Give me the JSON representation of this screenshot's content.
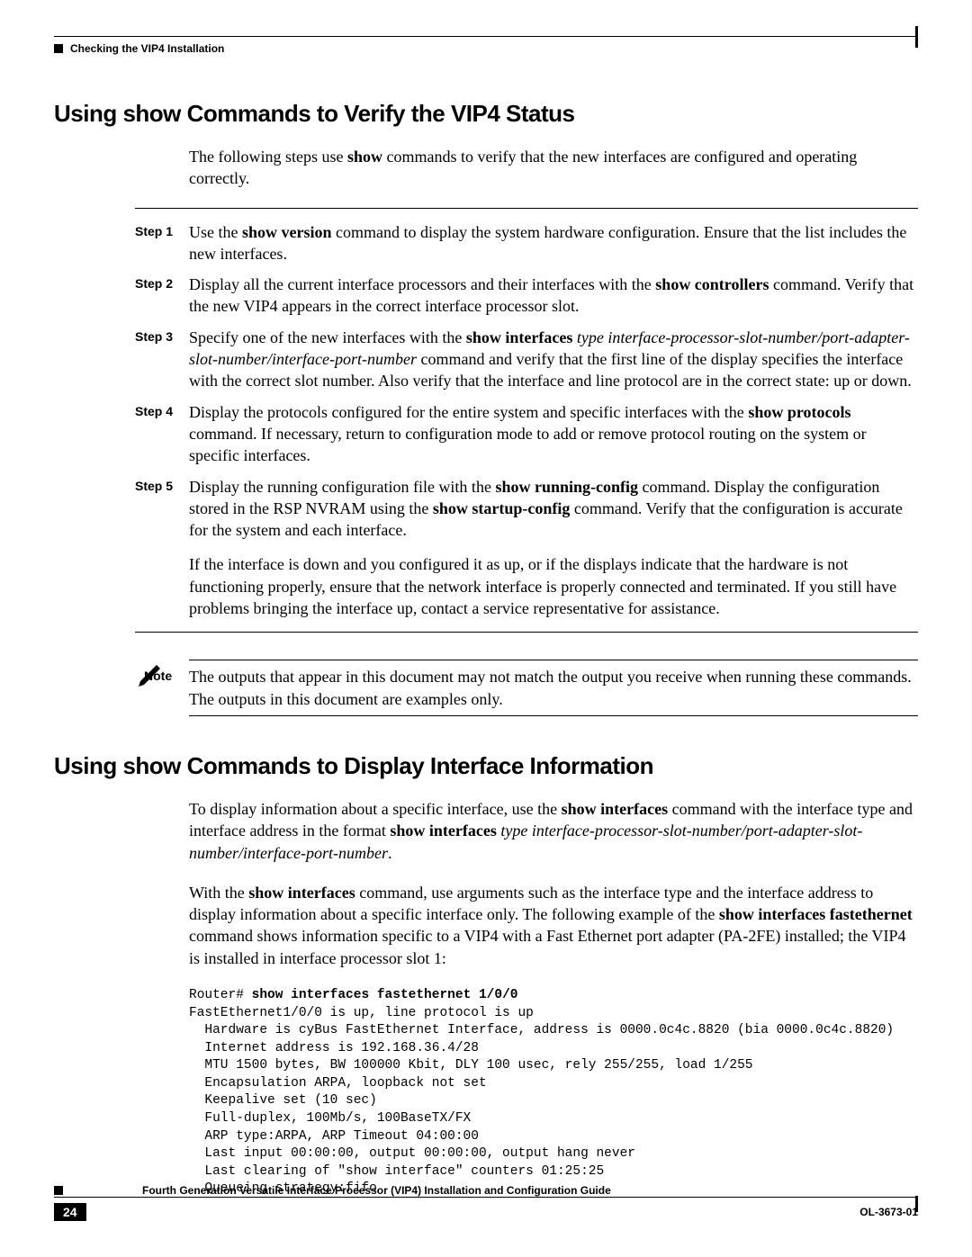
{
  "header": {
    "breadcrumb": "Checking the VIP4 Installation"
  },
  "section1": {
    "heading": "Using show Commands to Verify the VIP4 Status",
    "intro_pre": "The following steps use ",
    "intro_bold": "show",
    "intro_post": " commands to verify that the new interfaces are configured and operating correctly.",
    "steps": [
      {
        "label": "Step 1",
        "parts": [
          {
            "t": "Use the "
          },
          {
            "t": "show version",
            "b": true
          },
          {
            "t": " command to display the system hardware configuration. Ensure that the list includes the new interfaces."
          }
        ]
      },
      {
        "label": "Step 2",
        "parts": [
          {
            "t": "Display all the current interface processors and their interfaces with the "
          },
          {
            "t": "show controllers",
            "b": true
          },
          {
            "t": " command. Verify that the new VIP4 appears in the correct interface processor slot."
          }
        ]
      },
      {
        "label": "Step 3",
        "parts": [
          {
            "t": "Specify one of the new interfaces with the "
          },
          {
            "t": "show interfaces",
            "b": true
          },
          {
            "t": " "
          },
          {
            "t": "type interface-processor-slot-number/port-adapter-slot-number/interface-port-number",
            "i": true
          },
          {
            "t": " command and verify that the first line of the display specifies the interface with the correct slot number. Also verify that the interface and line protocol are in the correct state: up or down."
          }
        ]
      },
      {
        "label": "Step 4",
        "parts": [
          {
            "t": "Display the protocols configured for the entire system and specific interfaces with the "
          },
          {
            "t": "show protocols",
            "b": true
          },
          {
            "t": " command. If necessary, return to configuration mode to add or remove protocol routing on the system or specific interfaces."
          }
        ]
      },
      {
        "label": "Step 5",
        "parts": [
          {
            "t": "Display the running configuration file with the "
          },
          {
            "t": "show running-config",
            "b": true
          },
          {
            "t": " command. Display the configuration stored in the RSP NVRAM using the "
          },
          {
            "t": "show startup-config",
            "b": true
          },
          {
            "t": " command. Verify that the configuration is accurate for the system and each interface."
          }
        ]
      }
    ],
    "followup": "If the interface is down and you configured it as up, or if the displays indicate that the hardware is not functioning properly, ensure that the network interface is properly connected and terminated. If you still have problems bringing the interface up, contact a service representative for assistance."
  },
  "note": {
    "label": "Note",
    "text": "The outputs that appear in this document may not match the output you receive when running these commands. The outputs in this document are examples only."
  },
  "section2": {
    "heading": "Using show Commands to Display Interface Information",
    "para1_parts": [
      {
        "t": "To display information about a specific interface, use the "
      },
      {
        "t": "show interfaces",
        "b": true
      },
      {
        "t": " command with the interface type and interface address in the format "
      },
      {
        "t": "show interfaces",
        "b": true
      },
      {
        "t": " "
      },
      {
        "t": "type interface-processor-slot-number/port-adapter-slot-number/interface-port-number",
        "i": true
      },
      {
        "t": "."
      }
    ],
    "para2_parts": [
      {
        "t": "With the "
      },
      {
        "t": "show interfaces",
        "b": true
      },
      {
        "t": " command, use arguments such as the interface type and the interface address to display information about a specific interface only. The following example of the "
      },
      {
        "t": "show interfaces fastethernet",
        "b": true
      },
      {
        "t": " command shows information specific to a VIP4 with a Fast Ethernet port adapter (PA-2FE) installed; the VIP4 is installed in interface processor slot 1:"
      }
    ],
    "code_prompt": "Router# ",
    "code_cmd": "show interfaces fastethernet 1/0/0",
    "code_lines": [
      "FastEthernet1/0/0 is up, line protocol is up",
      "  Hardware is cyBus FastEthernet Interface, address is 0000.0c4c.8820 (bia 0000.0c4c.8820)",
      "  Internet address is 192.168.36.4/28",
      "  MTU 1500 bytes, BW 100000 Kbit, DLY 100 usec, rely 255/255, load 1/255",
      "  Encapsulation ARPA, loopback not set",
      "  Keepalive set (10 sec)",
      "  Full-duplex, 100Mb/s, 100BaseTX/FX",
      "  ARP type:ARPA, ARP Timeout 04:00:00",
      "  Last input 00:00:00, output 00:00:00, output hang never",
      "  Last clearing of \"show interface\" counters 01:25:25",
      "  Queueing strategy:fifo"
    ]
  },
  "footer": {
    "title": "Fourth Generation Versatile Interface Processor (VIP4) Installation and Configuration Guide",
    "page_number": "24",
    "doc_id": "OL-3673-01"
  }
}
